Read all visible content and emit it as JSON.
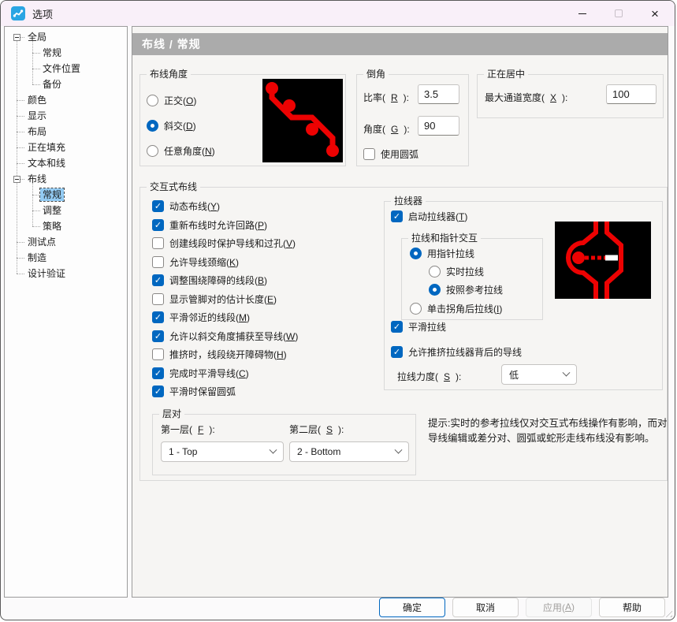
{
  "window": {
    "title": "选项",
    "icons": {
      "app": "pcb-trace-icon",
      "minimize": "minimize-icon",
      "maximize": "maximize-icon",
      "close": "close-icon"
    }
  },
  "sidebar": {
    "items": [
      {
        "label": "全局",
        "level": 0,
        "expanded": true,
        "selected": false
      },
      {
        "label": "常规",
        "level": 1,
        "selected": false
      },
      {
        "label": "文件位置",
        "level": 1,
        "selected": false
      },
      {
        "label": "备份",
        "level": 1,
        "selected": false
      },
      {
        "label": "颜色",
        "level": 0,
        "selected": false
      },
      {
        "label": "显示",
        "level": 0,
        "selected": false
      },
      {
        "label": "布局",
        "level": 0,
        "selected": false
      },
      {
        "label": "正在填充",
        "level": 0,
        "selected": false
      },
      {
        "label": "文本和线",
        "level": 0,
        "selected": false
      },
      {
        "label": "布线",
        "level": 0,
        "expanded": true,
        "selected": false
      },
      {
        "label": "常规",
        "level": 1,
        "selected": true
      },
      {
        "label": "调整",
        "level": 1,
        "selected": false
      },
      {
        "label": "策略",
        "level": 1,
        "selected": false
      },
      {
        "label": "测试点",
        "level": 0,
        "selected": false
      },
      {
        "label": "制造",
        "level": 0,
        "selected": false
      },
      {
        "label": "设计验证",
        "level": 0,
        "selected": false
      }
    ]
  },
  "header": {
    "title": "布线 / 常规"
  },
  "routing_angle": {
    "title": "布线角度",
    "options": [
      {
        "label": "正交(O)",
        "selected": false
      },
      {
        "label": "斜交(D)",
        "selected": true
      },
      {
        "label": "任意角度(N)",
        "selected": false
      }
    ],
    "image": "routing-angle-preview"
  },
  "mitering": {
    "title": "倒角",
    "ratio_label": "比率(R):",
    "ratio_value": "3.5",
    "angle_label": "角度(G):",
    "angle_value": "90",
    "use_arcs_label": "使用圆弧",
    "use_arcs_checked": false
  },
  "centering": {
    "title": "正在居中",
    "max_channel_label": "最大通道宽度(X):",
    "max_channel_value": "100"
  },
  "interactive_routing": {
    "title": "交互式布线",
    "checkboxes": [
      {
        "label": "动态布线(Y)",
        "checked": true
      },
      {
        "label": "重新布线时允许回路(P)",
        "checked": true
      },
      {
        "label": "创建线段时保护导线和过孔(V)",
        "checked": false
      },
      {
        "label": "允许导线颈缩(K)",
        "checked": false
      },
      {
        "label": "调整围绕障碍的线段(B)",
        "checked": true
      },
      {
        "label": "显示管脚对的估计长度(E)",
        "checked": false
      },
      {
        "label": "平滑邻近的线段(M)",
        "checked": true
      },
      {
        "label": "允许以斜交角度捕获至导线(W)",
        "checked": true
      },
      {
        "label": "推挤时，线段绕开障碍物(H)",
        "checked": false
      },
      {
        "label": "完成时平滑导线(C)",
        "checked": true
      },
      {
        "label": "平滑时保留圆弧",
        "checked": true
      }
    ]
  },
  "hug": {
    "title": "拉线器",
    "enable_label": "启动拉线器(T)",
    "enable_checked": true,
    "interaction": {
      "title": "拉线和指针交互",
      "options": [
        {
          "label": "用指针拉线",
          "selected": true,
          "level": 0
        },
        {
          "label": "实时拉线",
          "selected": false,
          "level": 1
        },
        {
          "label": "按照参考拉线",
          "selected": true,
          "level": 1
        },
        {
          "label": "单击拐角后拉线(I)",
          "selected": false,
          "level": 0
        }
      ]
    },
    "smooth_label": "平滑拉线",
    "smooth_checked": true,
    "push_label": "允许推挤拉线器背后的导线",
    "push_checked": true,
    "strength_label": "拉线力度(S):",
    "strength_value": "低",
    "image": "hug-preview"
  },
  "layer_pair": {
    "title": "层对",
    "first_label": "第一层(F):",
    "first_value": "1 - Top",
    "second_label": "第二层(S):",
    "second_value": "2 - Bottom"
  },
  "hint": {
    "text": "提示:实时的参考拉线仅对交互式布线操作有影响，而对导线编辑或差分对、圆弧或蛇形走线布线没有影响。"
  },
  "footer": {
    "ok": "确定",
    "cancel": "取消",
    "apply": "应用(A)",
    "help": "帮助"
  },
  "colors": {
    "accent": "#0067c0",
    "trace_red": "#ed0202",
    "image_bg": "#000000",
    "header_bg": "#ababab",
    "selection_bg": "#93cbf3",
    "titlebar_bg": "#f9f0f9"
  }
}
